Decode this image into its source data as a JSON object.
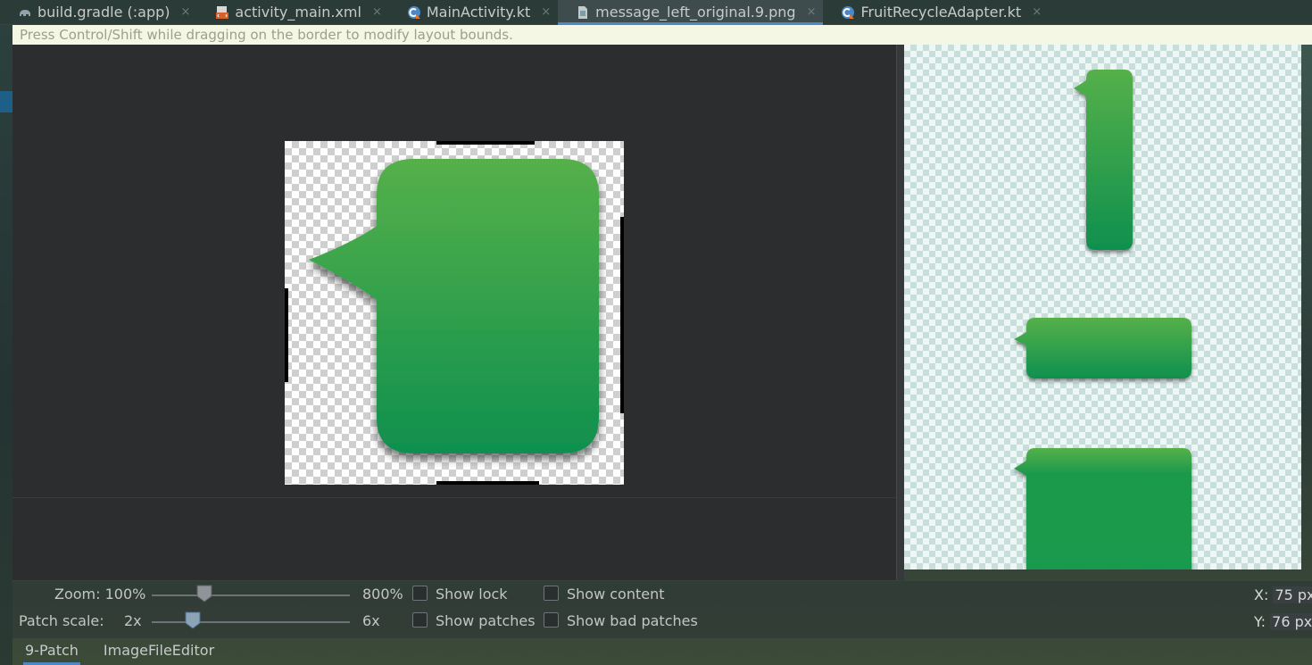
{
  "tabs": [
    {
      "label": "build.gradle (:app)",
      "icon": "gradle-elephant-icon",
      "active": false
    },
    {
      "label": "activity_main.xml",
      "icon": "xml-layout-file-icon",
      "active": false
    },
    {
      "label": "MainActivity.kt",
      "icon": "kotlin-class-icon",
      "active": false
    },
    {
      "label": "message_left_original.9.png",
      "icon": "image-file-icon",
      "active": true
    },
    {
      "label": "FruitRecycleAdapter.kt",
      "icon": "kotlin-class-icon",
      "active": false
    }
  ],
  "tab_close_glyph": "×",
  "hint": "Press Control/Shift while dragging on the border to modify layout bounds.",
  "controls": {
    "zoom_label": "Zoom: 100%",
    "zoom_max_label": "800%",
    "zoom_value_percent": 100,
    "patch_scale_label": "Patch scale:",
    "patch_scale_min_label": "2x",
    "patch_scale_max_label": "6x",
    "show_lock": "Show lock",
    "show_content": "Show content",
    "show_patches": "Show patches",
    "show_bad_patches": "Show bad patches",
    "x_label": "X:",
    "x_value": "75 px",
    "y_label": "Y:",
    "y_value": "76 px"
  },
  "bottom_tabs": [
    {
      "label": "9-Patch",
      "active": true
    },
    {
      "label": "ImageFileEditor",
      "active": false
    }
  ],
  "colors": {
    "bubble_top": "#55b04a",
    "bubble_bottom": "#0f904f",
    "accent": "#4a88c7",
    "hint_bg": "#f4f7e4"
  }
}
